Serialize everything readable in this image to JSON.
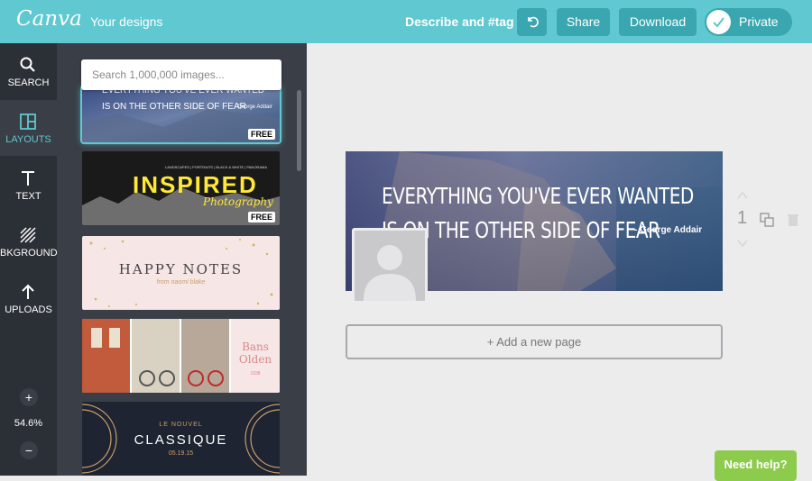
{
  "topbar": {
    "logo": "Canva",
    "your_designs": "Your designs",
    "describe": "Describe and #tag",
    "share": "Share",
    "download": "Download",
    "private": "Private",
    "accent": "#5fc8d0"
  },
  "sidebar": {
    "items": [
      {
        "label": "SEARCH",
        "icon": "search-icon"
      },
      {
        "label": "LAYOUTS",
        "icon": "layouts-icon"
      },
      {
        "label": "TEXT",
        "icon": "text-icon"
      },
      {
        "label": "BKGROUND",
        "icon": "background-icon"
      },
      {
        "label": "UPLOADS",
        "icon": "upload-icon"
      }
    ],
    "zoom_in": "+",
    "zoom_out": "−",
    "zoom": "54.6%"
  },
  "panel": {
    "search_placeholder": "Search 1,000,000 images...",
    "templates": [
      {
        "line1": "EVERYTHING YOU'VE EVER WANTED",
        "line2": "IS ON THE OTHER SIDE OF FEAR",
        "author": "George Addair",
        "badge": "FREE"
      },
      {
        "topline": "LANDSCAPES | PORTRAITS | BLACK & WHITE | PANORAMA",
        "title": "INSPIRED",
        "script": "Photography",
        "badge": "FREE"
      },
      {
        "title": "HAPPY NOTES",
        "subtitle": "from naomi blake"
      },
      {
        "name1": "Bans",
        "name2": "Olden",
        "year": "1938"
      },
      {
        "top": "LE NOUVEL",
        "title": "CLASSIQUE",
        "date": "05.19.15"
      }
    ]
  },
  "canvas": {
    "quote_line1": "EVERYTHING YOU'VE EVER WANTED",
    "quote_line2": "IS ON THE OTHER SIDE OF FEAR",
    "author": "- George Addair",
    "add_page": "+ Add a new page",
    "page_number": "1"
  },
  "help": "Need help?"
}
